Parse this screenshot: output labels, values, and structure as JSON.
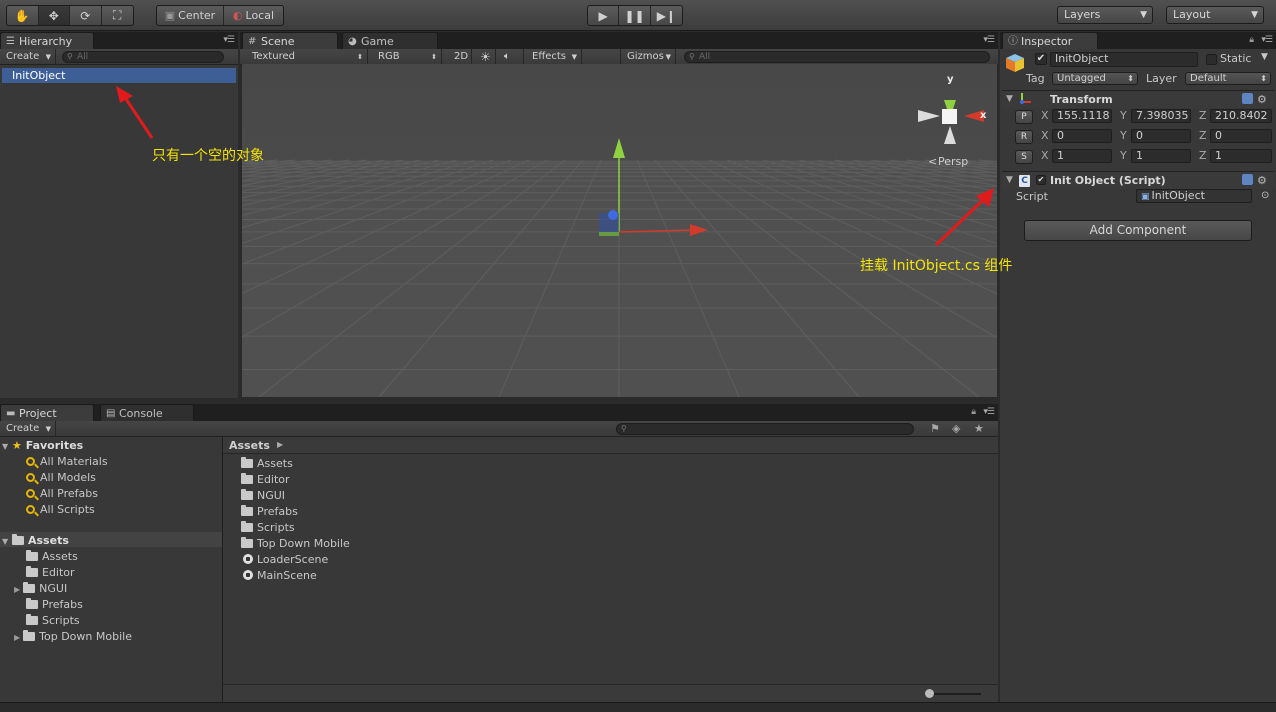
{
  "toolbar": {
    "pivot_mode": "Center",
    "pivot_rotation": "Local",
    "layers_label": "Layers",
    "layout_label": "Layout"
  },
  "hierarchy": {
    "tab_label": "Hierarchy",
    "create_label": "Create",
    "search_placeholder": "All",
    "items": [
      "InitObject"
    ],
    "selected": "InitObject"
  },
  "scene": {
    "tabs": [
      {
        "label": "Scene"
      },
      {
        "label": "Game"
      }
    ],
    "shading_mode": "Textured",
    "render_mode": "RGB",
    "mode_2d_label": "2D",
    "effects_label": "Effects",
    "gizmos_label": "Gizmos",
    "search_placeholder": "All",
    "projection_label": "Persp",
    "gizmo_axes": {
      "y": "y",
      "x": "x"
    }
  },
  "inspector": {
    "tab_label": "Inspector",
    "object_name": "InitObject",
    "active": true,
    "static_label": "Static",
    "tag_label": "Tag",
    "tag_value": "Untagged",
    "layer_label": "Layer",
    "layer_value": "Default",
    "transform": {
      "title": "Transform",
      "rows": [
        {
          "key": "P",
          "x": "155.1118",
          "y": "7.398035",
          "z": "210.8402"
        },
        {
          "key": "R",
          "x": "0",
          "y": "0",
          "z": "0"
        },
        {
          "key": "S",
          "x": "1",
          "y": "1",
          "z": "1"
        }
      ],
      "axis_labels": [
        "X",
        "Y",
        "Z"
      ]
    },
    "script_component": {
      "title": "Init Object (Script)",
      "script_label": "Script",
      "script_value": "InitObject"
    },
    "add_component_label": "Add Component"
  },
  "project": {
    "tabs": [
      {
        "label": "Project"
      },
      {
        "label": "Console"
      }
    ],
    "create_label": "Create",
    "favorites_label": "Favorites",
    "favorites": [
      "All Materials",
      "All Models",
      "All Prefabs",
      "All Scripts"
    ],
    "assets_label": "Assets",
    "asset_tree": [
      "Assets",
      "Editor",
      "NGUI",
      "Prefabs",
      "Scripts",
      "Top Down Mobile"
    ],
    "breadcrumb": "Assets",
    "asset_list": [
      {
        "name": "Assets",
        "kind": "folder"
      },
      {
        "name": "Editor",
        "kind": "folder"
      },
      {
        "name": "NGUI",
        "kind": "folder"
      },
      {
        "name": "Prefabs",
        "kind": "folder"
      },
      {
        "name": "Scripts",
        "kind": "folder"
      },
      {
        "name": "Top Down Mobile",
        "kind": "folder"
      },
      {
        "name": "LoaderScene",
        "kind": "scene"
      },
      {
        "name": "MainScene",
        "kind": "scene"
      }
    ]
  },
  "annotations": {
    "hierarchy_note": "只有一个空的对象",
    "inspector_note": "挂载 InitObject.cs 组件"
  },
  "colors": {
    "selection": "#3e5f96",
    "annotation": "#f5e400",
    "arrow": "#e01b1b"
  }
}
